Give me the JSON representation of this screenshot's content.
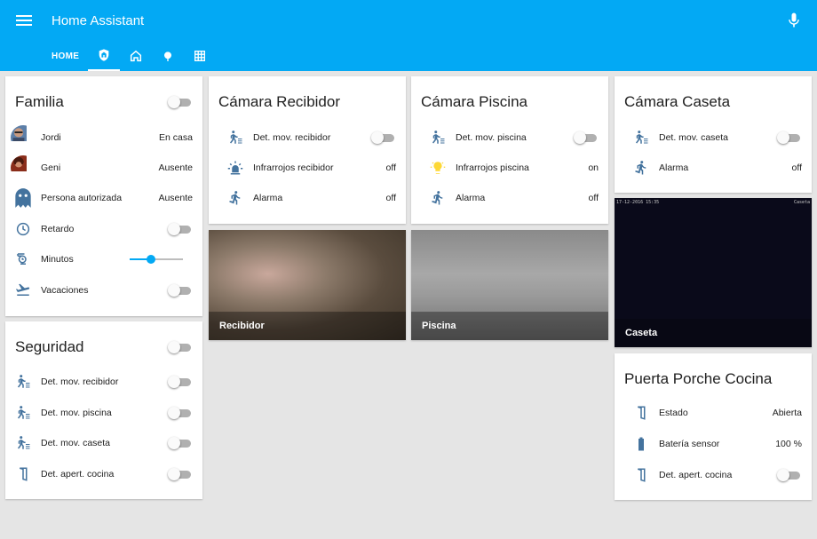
{
  "app": {
    "title": "Home Assistant"
  },
  "tabs": [
    {
      "label": "HOME",
      "icon": "text"
    },
    {
      "label": "",
      "icon": "shield-home-icon"
    },
    {
      "label": "",
      "icon": "home-outline-icon"
    },
    {
      "label": "",
      "icon": "tree-icon"
    },
    {
      "label": "",
      "icon": "grid-icon"
    }
  ],
  "colors": {
    "primary": "#03a9f4",
    "icon": "#44739e",
    "sun": "#fdd835"
  },
  "familia": {
    "title": "Familia",
    "toggle_on": false,
    "rows": [
      {
        "icon": "avatar-jordi",
        "label": "Jordi",
        "value": "En casa"
      },
      {
        "icon": "avatar-geni",
        "label": "Geni",
        "value": "Ausente"
      },
      {
        "icon": "ghost-icon",
        "label": "Persona autorizada",
        "value": "Ausente"
      },
      {
        "icon": "clock-icon",
        "label": "Retardo",
        "toggle": false
      },
      {
        "icon": "timer-icon",
        "label": "Minutos",
        "slider": 0.4
      },
      {
        "icon": "airplane-icon",
        "label": "Vacaciones",
        "toggle": false
      }
    ]
  },
  "seguridad": {
    "title": "Seguridad",
    "toggle_on": false,
    "rows": [
      {
        "icon": "motion-sensor-icon",
        "label": "Det. mov. recibidor",
        "toggle": false
      },
      {
        "icon": "motion-sensor-icon",
        "label": "Det. mov. piscina",
        "toggle": false
      },
      {
        "icon": "motion-sensor-icon",
        "label": "Det. mov. caseta",
        "toggle": false
      },
      {
        "icon": "door-icon",
        "label": "Det. apert. cocina",
        "toggle": false
      }
    ]
  },
  "camara_recibidor": {
    "title": "Cámara Recibidor",
    "rows": [
      {
        "icon": "motion-sensor-icon",
        "label": "Det. mov. recibidor",
        "toggle": false
      },
      {
        "icon": "alarm-light-icon",
        "label": "Infrarrojos recibidor",
        "value": "off"
      },
      {
        "icon": "walk-icon",
        "label": "Alarma",
        "value": "off"
      }
    ],
    "image_caption": "Recibidor"
  },
  "camara_piscina": {
    "title": "Cámara Piscina",
    "rows": [
      {
        "icon": "motion-sensor-icon",
        "label": "Det. mov. piscina",
        "toggle": false
      },
      {
        "icon": "lightbulb-icon",
        "label": "Infrarrojos piscina",
        "value": "on"
      },
      {
        "icon": "walk-icon",
        "label": "Alarma",
        "value": "off"
      }
    ],
    "image_caption": "Piscina"
  },
  "camara_caseta": {
    "title": "Cámara Caseta",
    "rows": [
      {
        "icon": "motion-sensor-icon",
        "label": "Det. mov. caseta",
        "toggle": false
      },
      {
        "icon": "walk-icon",
        "label": "Alarma",
        "value": "off"
      }
    ],
    "image_caption": "Caseta",
    "stamp_left": "17-12-2016 15:35",
    "stamp_right": "Caseta"
  },
  "puerta": {
    "title": "Puerta Porche Cocina",
    "rows": [
      {
        "icon": "door-icon",
        "label": "Estado",
        "value": "Abierta"
      },
      {
        "icon": "battery-icon",
        "label": "Batería sensor",
        "value": "100 %"
      },
      {
        "icon": "door-icon",
        "label": "Det. apert. cocina",
        "toggle": false
      }
    ]
  }
}
